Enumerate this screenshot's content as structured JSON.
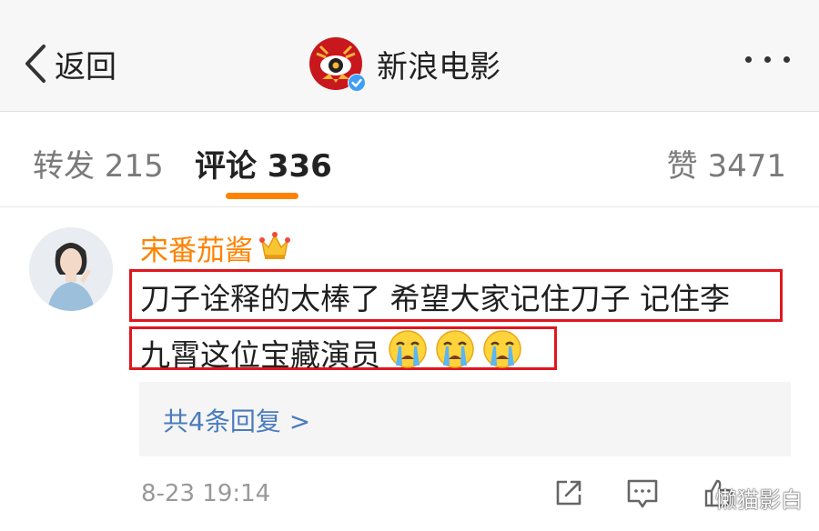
{
  "nav": {
    "back_label": "返回",
    "title": "新浪电影"
  },
  "tabs": {
    "repost": "转发 215",
    "comment": "评论 336",
    "like": "赞 3471",
    "active_color": "#ff8200"
  },
  "comment": {
    "username": "宋番茄酱",
    "text_line1": "刀子诠释的太棒了 希望大家记住刀子 记住李",
    "text_line2": "九霄这位宝藏演员",
    "emoji_count": 3,
    "replies_label": "共4条回复 >",
    "timestamp": "8-23 19:14"
  },
  "highlight_color": "#e0161e",
  "watermark": "懒猫影白"
}
